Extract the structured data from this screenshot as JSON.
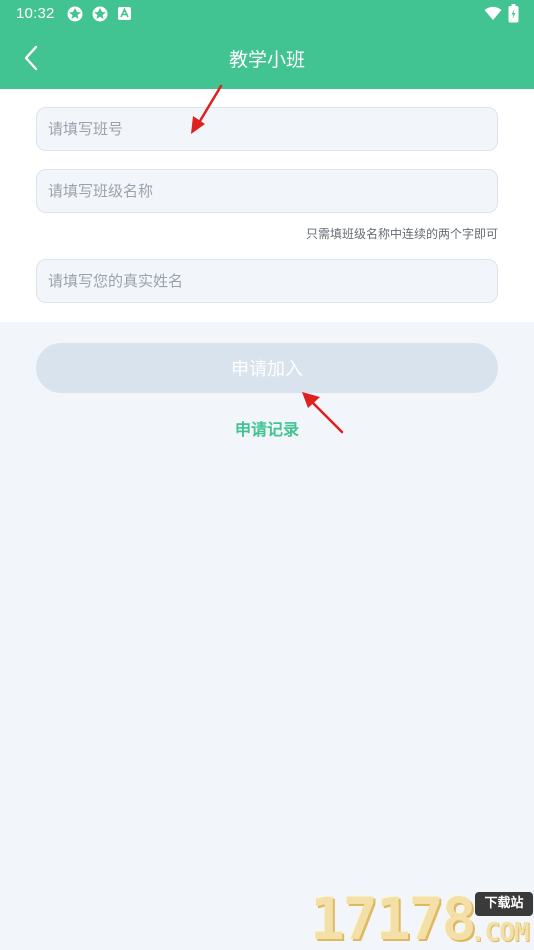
{
  "status_bar": {
    "time": "10:32",
    "icons": [
      "app-notification-icon",
      "app-notification-icon",
      "android-app-icon",
      "wifi-icon",
      "battery-icon"
    ]
  },
  "nav": {
    "back_icon": "chevron-left-icon",
    "title": "教学小班"
  },
  "form": {
    "class_number": {
      "value": "",
      "placeholder": "请填写班号"
    },
    "class_name": {
      "value": "",
      "placeholder": "请填写班级名称"
    },
    "class_name_hint": "只需填班级名称中连续的两个字即可",
    "real_name": {
      "value": "",
      "placeholder": "请填写您的真实姓名"
    }
  },
  "actions": {
    "join_label": "申请加入",
    "record_label": "申请记录"
  },
  "watermark": {
    "digits": "17178",
    "badge": "下载站",
    "domain": ".COM"
  },
  "colors": {
    "primary": "#42c392",
    "background": "#f2f5f9",
    "disabled_button": "#d8e3ee",
    "annotation_arrow": "#e0201e"
  }
}
